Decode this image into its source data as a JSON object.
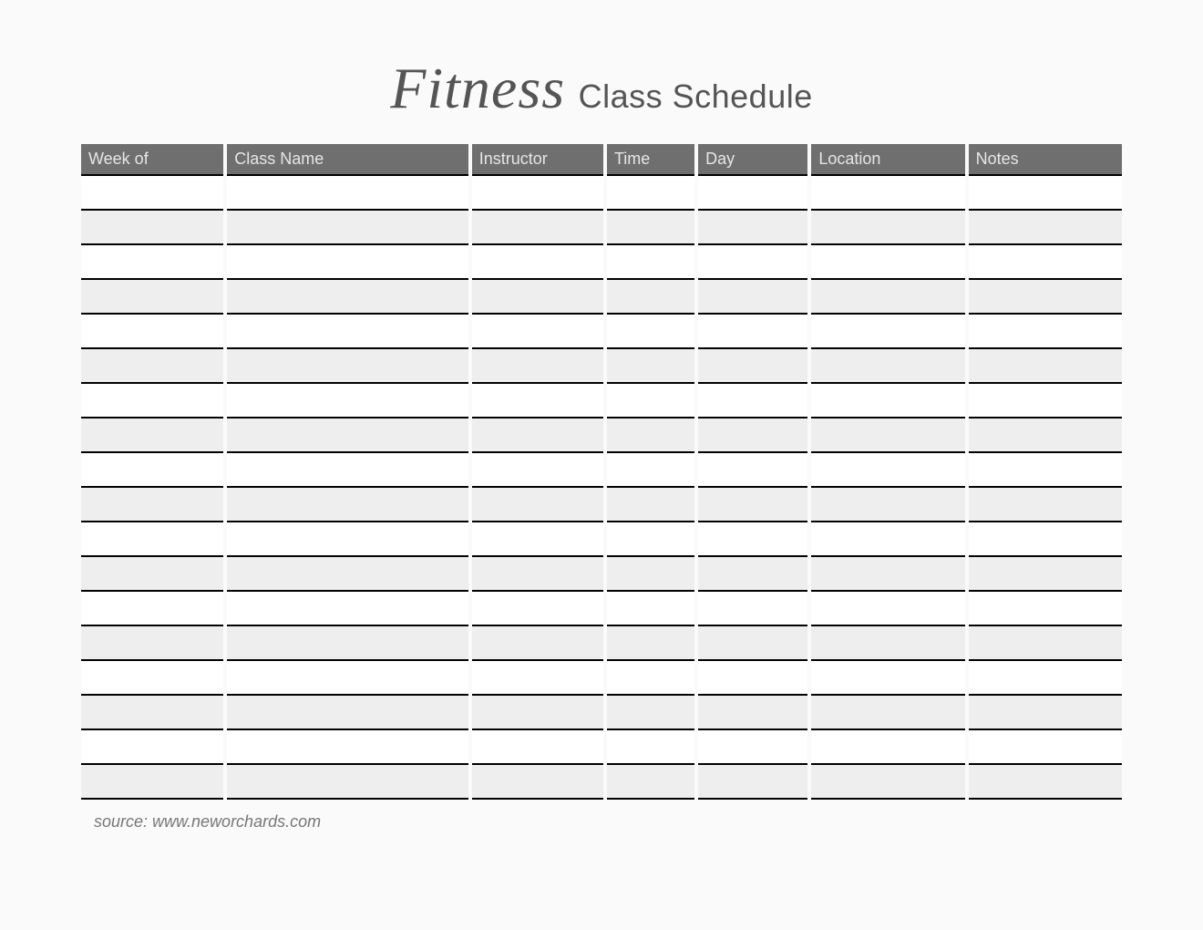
{
  "title": {
    "script": "Fitness",
    "rest": "Class Schedule"
  },
  "columns": [
    {
      "key": "week_of",
      "label": "Week of"
    },
    {
      "key": "class_name",
      "label": "Class Name"
    },
    {
      "key": "instructor",
      "label": "Instructor"
    },
    {
      "key": "time",
      "label": "Time"
    },
    {
      "key": "day",
      "label": "Day"
    },
    {
      "key": "location",
      "label": "Location"
    },
    {
      "key": "notes",
      "label": "Notes"
    }
  ],
  "rows": [
    {
      "week_of": "",
      "class_name": "",
      "instructor": "",
      "time": "",
      "day": "",
      "location": "",
      "notes": ""
    },
    {
      "week_of": "",
      "class_name": "",
      "instructor": "",
      "time": "",
      "day": "",
      "location": "",
      "notes": ""
    },
    {
      "week_of": "",
      "class_name": "",
      "instructor": "",
      "time": "",
      "day": "",
      "location": "",
      "notes": ""
    },
    {
      "week_of": "",
      "class_name": "",
      "instructor": "",
      "time": "",
      "day": "",
      "location": "",
      "notes": ""
    },
    {
      "week_of": "",
      "class_name": "",
      "instructor": "",
      "time": "",
      "day": "",
      "location": "",
      "notes": ""
    },
    {
      "week_of": "",
      "class_name": "",
      "instructor": "",
      "time": "",
      "day": "",
      "location": "",
      "notes": ""
    },
    {
      "week_of": "",
      "class_name": "",
      "instructor": "",
      "time": "",
      "day": "",
      "location": "",
      "notes": ""
    },
    {
      "week_of": "",
      "class_name": "",
      "instructor": "",
      "time": "",
      "day": "",
      "location": "",
      "notes": ""
    },
    {
      "week_of": "",
      "class_name": "",
      "instructor": "",
      "time": "",
      "day": "",
      "location": "",
      "notes": ""
    },
    {
      "week_of": "",
      "class_name": "",
      "instructor": "",
      "time": "",
      "day": "",
      "location": "",
      "notes": ""
    },
    {
      "week_of": "",
      "class_name": "",
      "instructor": "",
      "time": "",
      "day": "",
      "location": "",
      "notes": ""
    },
    {
      "week_of": "",
      "class_name": "",
      "instructor": "",
      "time": "",
      "day": "",
      "location": "",
      "notes": ""
    },
    {
      "week_of": "",
      "class_name": "",
      "instructor": "",
      "time": "",
      "day": "",
      "location": "",
      "notes": ""
    },
    {
      "week_of": "",
      "class_name": "",
      "instructor": "",
      "time": "",
      "day": "",
      "location": "",
      "notes": ""
    },
    {
      "week_of": "",
      "class_name": "",
      "instructor": "",
      "time": "",
      "day": "",
      "location": "",
      "notes": ""
    },
    {
      "week_of": "",
      "class_name": "",
      "instructor": "",
      "time": "",
      "day": "",
      "location": "",
      "notes": ""
    },
    {
      "week_of": "",
      "class_name": "",
      "instructor": "",
      "time": "",
      "day": "",
      "location": "",
      "notes": ""
    },
    {
      "week_of": "",
      "class_name": "",
      "instructor": "",
      "time": "",
      "day": "",
      "location": "",
      "notes": ""
    }
  ],
  "source": "source: www.neworchards.com"
}
